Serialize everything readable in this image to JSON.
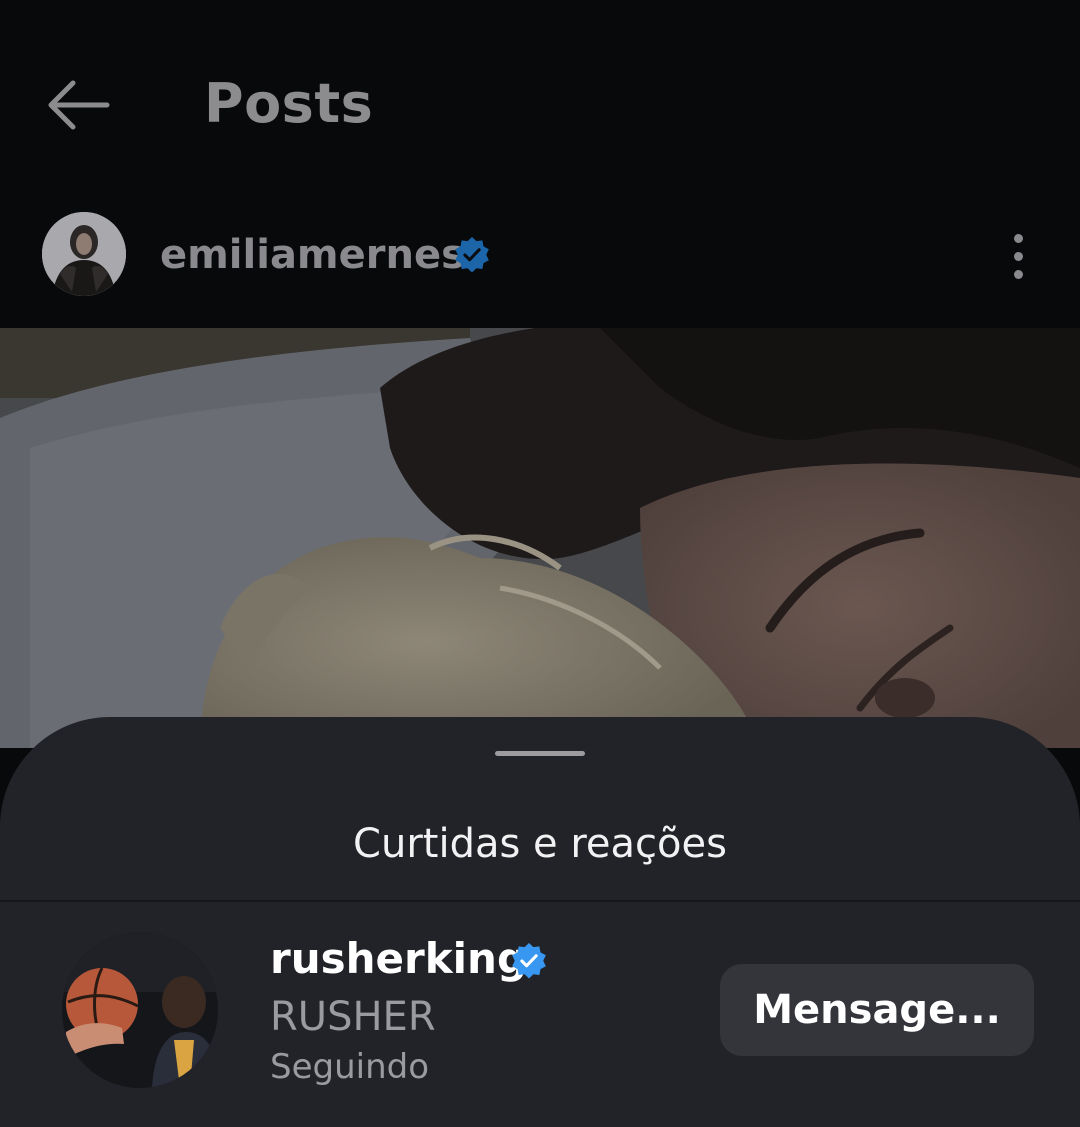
{
  "header": {
    "back_icon": "arrow-left-icon",
    "title": "Posts"
  },
  "post": {
    "author": {
      "username": "emiliamernes",
      "verified": true,
      "verified_icon": "verified-badge-icon"
    },
    "more_icon": "more-vertical-icon"
  },
  "likes_sheet": {
    "title": "Curtidas e reações",
    "users": [
      {
        "username": "rusherking",
        "verified": true,
        "full_name": "RUSHER",
        "status": "Seguindo",
        "action_label": "Mensage..."
      }
    ]
  },
  "colors": {
    "background": "#08090b",
    "sheet": "#222328",
    "verified_blue": "#3897f0",
    "button": "#33353b"
  }
}
